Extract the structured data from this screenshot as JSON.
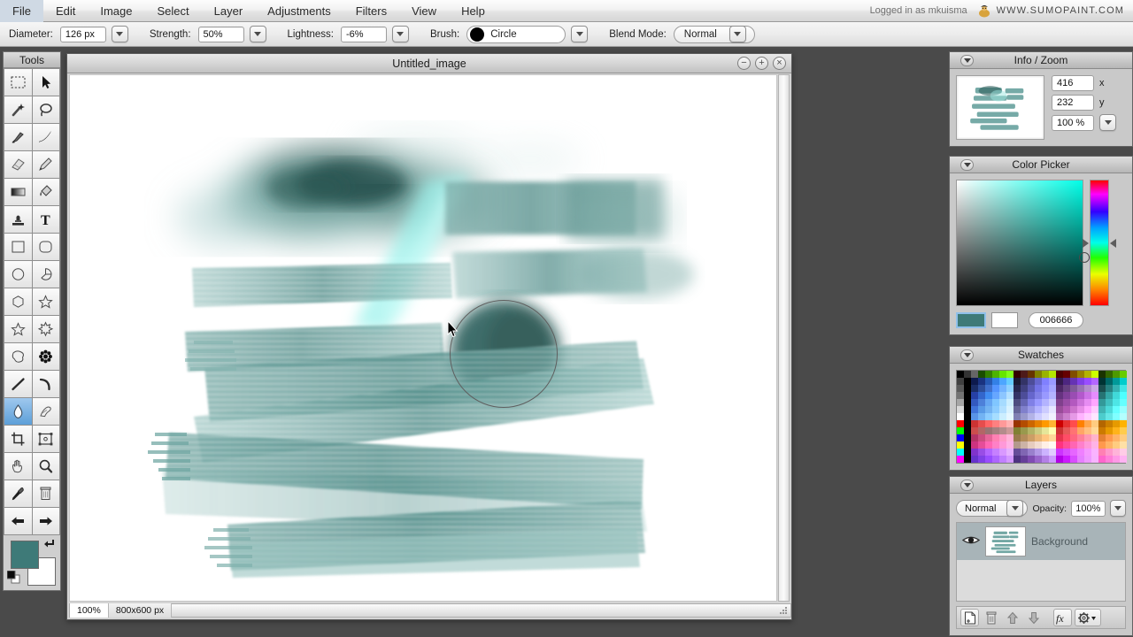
{
  "menubar": {
    "items": [
      {
        "label": "File"
      },
      {
        "label": "Edit"
      },
      {
        "label": "Image"
      },
      {
        "label": "Select"
      },
      {
        "label": "Layer"
      },
      {
        "label": "Adjustments"
      },
      {
        "label": "Filters"
      },
      {
        "label": "View"
      },
      {
        "label": "Help"
      }
    ],
    "login_status": "Logged in as mkuisma",
    "site_url": "WWW.SUMOPAINT.COM",
    "logo_icon": "sumo-wrestler-icon"
  },
  "options_bar": {
    "diameter_label": "Diameter:",
    "diameter_value": "126 px",
    "strength_label": "Strength:",
    "strength_value": "50%",
    "lightness_label": "Lightness:",
    "lightness_value": "-6%",
    "brush_label": "Brush:",
    "brush_value": "Circle",
    "blend_label": "Blend Mode:",
    "blend_value": "Normal"
  },
  "tools": {
    "title": "Tools",
    "selected_index": 24,
    "items": [
      {
        "name": "rectangular-marquee",
        "icon": "marquee-icon"
      },
      {
        "name": "move",
        "icon": "arrow-pointer-icon"
      },
      {
        "name": "magic-wand",
        "icon": "magic-wand-icon"
      },
      {
        "name": "lasso",
        "icon": "lasso-icon"
      },
      {
        "name": "paint-brush",
        "icon": "paintbrush-icon"
      },
      {
        "name": "ink-brush",
        "icon": "ink-stroke-icon"
      },
      {
        "name": "eraser",
        "icon": "eraser-icon"
      },
      {
        "name": "pencil",
        "icon": "pencil-icon"
      },
      {
        "name": "gradient",
        "icon": "gradient-icon"
      },
      {
        "name": "paint-bucket",
        "icon": "paint-bucket-icon"
      },
      {
        "name": "clone-stamp",
        "icon": "stamp-icon"
      },
      {
        "name": "text",
        "icon": "text-t-icon"
      },
      {
        "name": "rectangle-shape",
        "icon": "square-icon"
      },
      {
        "name": "rounded-rectangle-shape",
        "icon": "rounded-square-icon"
      },
      {
        "name": "ellipse-shape",
        "icon": "circle-icon"
      },
      {
        "name": "pie-shape",
        "icon": "pie-icon"
      },
      {
        "name": "polygon-shape",
        "icon": "hexagon-icon"
      },
      {
        "name": "star-shape",
        "icon": "star-icon"
      },
      {
        "name": "star5-shape",
        "icon": "star-outline-icon"
      },
      {
        "name": "burst-shape",
        "icon": "burst-icon"
      },
      {
        "name": "blob-shape",
        "icon": "blob-icon"
      },
      {
        "name": "flower-shape",
        "icon": "flower-icon"
      },
      {
        "name": "line",
        "icon": "line-icon"
      },
      {
        "name": "curve",
        "icon": "curve-icon"
      },
      {
        "name": "smudge",
        "icon": "water-drop-icon"
      },
      {
        "name": "blur-sharpen",
        "icon": "finger-smudge-icon"
      },
      {
        "name": "crop",
        "icon": "crop-icon"
      },
      {
        "name": "transform",
        "icon": "transform-frame-icon"
      },
      {
        "name": "hand",
        "icon": "hand-icon"
      },
      {
        "name": "zoom",
        "icon": "magnifier-icon"
      },
      {
        "name": "eyedropper",
        "icon": "eyedropper-icon"
      },
      {
        "name": "trash",
        "icon": "trash-can-icon"
      },
      {
        "name": "undo-arrow",
        "icon": "arrow-left-icon"
      },
      {
        "name": "redo-arrow",
        "icon": "arrow-right-icon"
      }
    ],
    "foreground_color": "#3e7a78",
    "background_color": "#ffffff",
    "swap_icon": "swap-colors-icon",
    "default_icon": "default-colors-icon"
  },
  "canvas_window": {
    "title": "Untitled_image",
    "minimize_icon": "minimize-icon",
    "maximize_icon": "maximize-icon",
    "close_icon": "close-icon",
    "status_zoom": "100%",
    "status_size": "800x600 px",
    "resize_grip_icon": "resize-grip-icon",
    "cursor_icon": "mouse-pointer-icon",
    "brush_cursor_icon": "brush-circle-outline"
  },
  "info_zoom": {
    "title": "Info / Zoom",
    "x_value": "416",
    "x_label": "x",
    "y_value": "232",
    "y_label": "y",
    "zoom_value": "100 %",
    "collapse_icon": "chevron-down-icon"
  },
  "color_picker": {
    "title": "Color Picker",
    "hex_value": "006666",
    "foreground_color": "#3e7a78",
    "background_color": "#ffffff",
    "hue_color": "#00ffe8",
    "collapse_icon": "chevron-down-icon"
  },
  "swatches": {
    "title": "Swatches",
    "collapse_icon": "chevron-down-icon",
    "colors": [
      "#000000",
      "#333333",
      "#666666",
      "#1a4d00",
      "#338000",
      "#4db300",
      "#66e600",
      "#80ff1a",
      "#330000",
      "#4d1a1a",
      "#663300",
      "#808000",
      "#99b300",
      "#b3e600",
      "#4d0000",
      "#660000",
      "#804d00",
      "#998000",
      "#b3b300",
      "#ccff00",
      "#1a3300",
      "#336600",
      "#4d9900",
      "#66cc00",
      "#404040",
      "#000000",
      "#0d1a4d",
      "#1a3380",
      "#2659b3",
      "#3380e6",
      "#4da6ff",
      "#66ccff",
      "#1a1a33",
      "#333366",
      "#4d4d99",
      "#6666cc",
      "#8080ff",
      "#9999ff",
      "#331a4d",
      "#4d2680",
      "#6633b3",
      "#8040e6",
      "#994dff",
      "#b366ff",
      "#003333",
      "#006666",
      "#009999",
      "#00cccc",
      "#595959",
      "#000000",
      "#1a2d66",
      "#2d4d99",
      "#4070cc",
      "#5394ff",
      "#73b3ff",
      "#8fd1ff",
      "#26264d",
      "#40407f",
      "#5959b3",
      "#7373e6",
      "#8c8cff",
      "#a6a6ff",
      "#4d2666",
      "#664080",
      "#805999",
      "#9973b3",
      "#b38ccc",
      "#cca6e6",
      "#1a4d4d",
      "#268080",
      "#33b3b3",
      "#40e6e6",
      "#737373",
      "#000000",
      "#2640a6",
      "#3366cc",
      "#408cf2",
      "#66a6ff",
      "#8cc6ff",
      "#b3e0ff",
      "#333366",
      "#4d4d99",
      "#6666cc",
      "#8080e6",
      "#9999ff",
      "#b3b3ff",
      "#663380",
      "#80409a",
      "#9a4db3",
      "#b359cc",
      "#cc73e6",
      "#e68cff",
      "#267373",
      "#33a6a6",
      "#40d9d9",
      "#4dffff",
      "#a6a6a6",
      "#000000",
      "#3359bf",
      "#4d80d9",
      "#66a6f2",
      "#80c6ff",
      "#a6dbff",
      "#cceeff",
      "#4d4d80",
      "#6666b3",
      "#8080e6",
      "#9999ff",
      "#b3b3ff",
      "#ccccff",
      "#80408c",
      "#9a4da6",
      "#b359bf",
      "#cc73d9",
      "#e68cf2",
      "#ffa6ff",
      "#339999",
      "#40bfbf",
      "#4de6e6",
      "#66ffff",
      "#d9d9d9",
      "#000000",
      "#4073d9",
      "#599ae6",
      "#73b3f2",
      "#8cccff",
      "#b3e0ff",
      "#d9f2ff",
      "#666699",
      "#8080cc",
      "#9999e6",
      "#b3b3ff",
      "#ccccff",
      "#e6e6ff",
      "#994d99",
      "#b359b3",
      "#cc73cc",
      "#e68ce6",
      "#ffa6ff",
      "#ffccff",
      "#40b3b3",
      "#4dd9d9",
      "#66ffff",
      "#99ffff",
      "#ffffff",
      "#000000",
      "#5993e6",
      "#73b3f2",
      "#8cccff",
      "#a6ddff",
      "#cceeff",
      "#e6f7ff",
      "#8080b3",
      "#9999cc",
      "#b3b3e6",
      "#ccccff",
      "#e0e0ff",
      "#f2f2ff",
      "#b366b3",
      "#cc80cc",
      "#e699e6",
      "#ffb3ff",
      "#ffccff",
      "#ffe6ff",
      "#4dcccc",
      "#66e6e6",
      "#80ffff",
      "#b3ffff",
      "#ff0000",
      "#000000",
      "#cc3333",
      "#e64d4d",
      "#ff6666",
      "#ff8080",
      "#ff9999",
      "#ffb3b3",
      "#993300",
      "#b34d00",
      "#cc6600",
      "#e68000",
      "#ff9900",
      "#ffb333",
      "#cc0000",
      "#e63333",
      "#ff4d4d",
      "#ff8000",
      "#ffa64d",
      "#ffcc80",
      "#b36600",
      "#cc8000",
      "#e69a00",
      "#ffb300",
      "#00ff00",
      "#000000",
      "#cc4d4d",
      "#b36666",
      "#997373",
      "#a68080",
      "#b38c8c",
      "#cc9999",
      "#808033",
      "#99994d",
      "#b3b366",
      "#cccc80",
      "#e6e699",
      "#ffffb3",
      "#cc3333",
      "#e65959",
      "#ff7373",
      "#ffa666",
      "#ffbf80",
      "#ffd999",
      "#cc7a00",
      "#e69900",
      "#ffb31a",
      "#ffcc4d",
      "#0000ff",
      "#000000",
      "#b33366",
      "#cc4d80",
      "#e66699",
      "#ff80b3",
      "#ff99c6",
      "#ffb3d9",
      "#997a4d",
      "#b38c5a",
      "#cc9e66",
      "#e6b373",
      "#ffc680",
      "#ffd999",
      "#e6334d",
      "#ff4d66",
      "#ff6680",
      "#ff8099",
      "#ff99b3",
      "#ffb3cc",
      "#e68033",
      "#ff994d",
      "#ffb366",
      "#ffcc80",
      "#ffff00",
      "#000000",
      "#cc3380",
      "#e64d99",
      "#ff66b3",
      "#ff80c6",
      "#ff99d9",
      "#ffb3e6",
      "#b3998c",
      "#ccb3a6",
      "#e6ccbf",
      "#f2ddd2",
      "#fff0e6",
      "#fffaf2",
      "#ff3380",
      "#ff4d99",
      "#ff66b3",
      "#ff80cc",
      "#ff99d9",
      "#ffb3e6",
      "#ff994d",
      "#ffb366",
      "#ffcc80",
      "#ffe0a6",
      "#00ffff",
      "#000000",
      "#8033cc",
      "#994de6",
      "#b366ff",
      "#c680ff",
      "#d999ff",
      "#e6b3ff",
      "#664d99",
      "#8066b3",
      "#9980cc",
      "#b399e6",
      "#ccb3ff",
      "#e0ccff",
      "#cc33ff",
      "#d94dff",
      "#e666ff",
      "#ef80ff",
      "#f599ff",
      "#fab3ff",
      "#ff80b3",
      "#ff99cc",
      "#ffb3d9",
      "#ffcce6",
      "#ff00ff",
      "#000000",
      "#6633cc",
      "#8040e6",
      "#994dff",
      "#ad66ff",
      "#c180ff",
      "#d499ff",
      "#4d3380",
      "#664099",
      "#804db3",
      "#9966cc",
      "#b380e6",
      "#cc99ff",
      "#b300e6",
      "#cc1aff",
      "#d94dff",
      "#e680ff",
      "#ef99ff",
      "#f7b3ff",
      "#ff66cc",
      "#ff80d9",
      "#ff99e6",
      "#ffb3f2"
    ]
  },
  "layers": {
    "title": "Layers",
    "blend_mode": "Normal",
    "opacity_label": "Opacity:",
    "opacity_value": "100%",
    "collapse_icon": "chevron-down-icon",
    "rows": [
      {
        "name": "Background",
        "visible": true,
        "visibility_icon": "eye-icon"
      }
    ],
    "buttons": [
      {
        "name": "new-layer",
        "icon": "new-page-icon"
      },
      {
        "name": "delete-layer",
        "icon": "trash-can-icon"
      },
      {
        "name": "move-layer-up",
        "icon": "arrow-up-icon"
      },
      {
        "name": "move-layer-down",
        "icon": "arrow-down-icon"
      },
      {
        "name": "layer-effects",
        "icon": "fx-icon"
      },
      {
        "name": "layer-settings",
        "icon": "gear-icon"
      }
    ]
  }
}
